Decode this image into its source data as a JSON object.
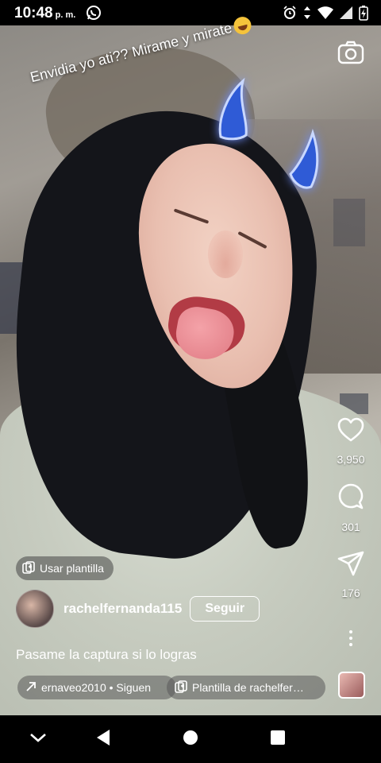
{
  "status_bar": {
    "time": "10:48",
    "ampm": "p. m.",
    "icons": [
      "whatsapp-icon",
      "alarm-icon",
      "data-arrows-icon",
      "wifi-icon",
      "signal-icon",
      "battery-charging-icon"
    ]
  },
  "story": {
    "caption_text": "Envidia yo ati?? Mirame y mirate",
    "caption_emoji": "grinning-face-emoji"
  },
  "actions": {
    "likes": "3,950",
    "comments": "301",
    "shares": "176"
  },
  "template_chip": {
    "label": "Usar plantilla"
  },
  "author": {
    "username": "rachelfernanda115",
    "follow_label": "Seguir"
  },
  "post_caption": "Pasame la captura si lo logras",
  "audio_pill": {
    "label": "ernaveo2010 • Siguen"
  },
  "template_pill": {
    "label": "Plantilla de rachelfer…"
  },
  "colors": {
    "accent_horn": "#2f5bd6",
    "chip_bg": "rgba(70,70,70,0.55)"
  }
}
